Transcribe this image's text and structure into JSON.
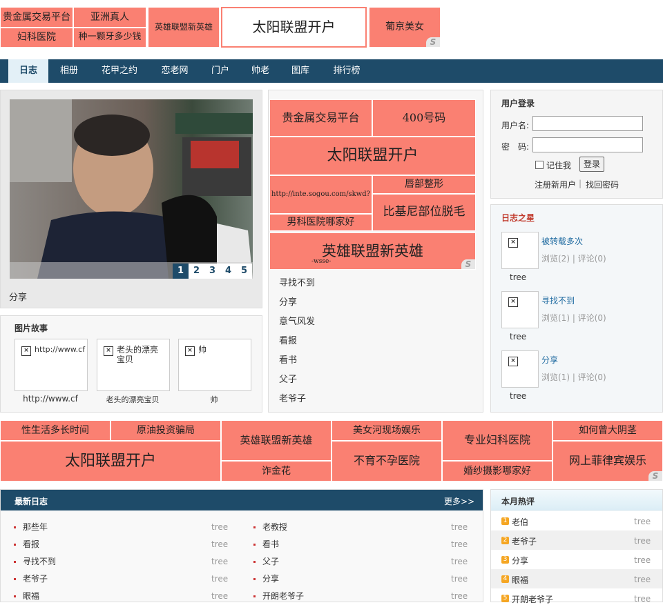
{
  "top_ads": {
    "a1": "贵金属交易平台",
    "a2": "亚洲真人",
    "a3": "妇科医院",
    "a4": "种一颗牙多少钱",
    "a5": "英雄联盟新英雄",
    "a6": "太阳联盟开户",
    "a7": "葡京美女"
  },
  "nav": [
    "日志",
    "相册",
    "花甲之约",
    "恋老网",
    "门户",
    "帅老",
    "图库",
    "排行榜"
  ],
  "slideshow": {
    "pages": [
      "1",
      "2",
      "3",
      "4",
      "5"
    ],
    "caption": "分享"
  },
  "photo_story": {
    "title": "图片故事",
    "items": [
      {
        "thumb_text": "http://www.cf",
        "caption": "http://www.cf"
      },
      {
        "thumb_text": "老头的漂亮宝贝",
        "caption": "老头的漂亮宝贝"
      },
      {
        "thumb_text": "帅",
        "caption": "帅"
      }
    ]
  },
  "mid_ads": {
    "m1": "贵金属交易平台",
    "m2": "400号码",
    "m3": "太阳联盟开户",
    "m4": "http://inte.sogou.com/skwd?",
    "m5": "唇部整形",
    "m6": "比基尼部位脱毛",
    "m7": "男科医院哪家好",
    "m8": "英雄联盟新英雄",
    "m8_sub": "-wsse-"
  },
  "mid_list": [
    "寻找不到",
    "分享",
    "意气风发",
    "看报",
    "看书",
    "父子",
    "老爷子"
  ],
  "login": {
    "title": "用户登录",
    "username_label": "用户名:",
    "password_label": "密　码:",
    "remember": "记住我",
    "submit": "登录",
    "register": "注册新用户",
    "sep": "|",
    "forgot": "找回密码"
  },
  "star": {
    "title": "日志之星",
    "items": [
      {
        "title": "被转载多次",
        "stats": "浏览(2) | 评论(0)",
        "user": "tree"
      },
      {
        "title": "寻找不到",
        "stats": "浏览(1) | 评论(0)",
        "user": "tree"
      },
      {
        "title": "分享",
        "stats": "浏览(1) | 评论(0)",
        "user": "tree"
      }
    ]
  },
  "band_ads": {
    "b1": "性生活多长时间",
    "b2": "原油投资骗局",
    "b3": "英雄联盟新英雄",
    "b4": "美女河现场娱乐",
    "b5": "专业妇科医院",
    "b6": "如何曾大阴茎",
    "b7": "太阳联盟开户",
    "b8": "不育不孕医院",
    "b9": "网上菲律宾娱乐",
    "b10": "诈金花",
    "b11": "婚纱摄影哪家好"
  },
  "latest": {
    "title": "最新日志",
    "more": "更多>>",
    "left": [
      {
        "title": "那些年",
        "user": "tree"
      },
      {
        "title": "看报",
        "user": "tree"
      },
      {
        "title": "寻找不到",
        "user": "tree"
      },
      {
        "title": "老爷子",
        "user": "tree"
      },
      {
        "title": "眼福",
        "user": "tree"
      }
    ],
    "right": [
      {
        "title": "老教授",
        "user": "tree"
      },
      {
        "title": "看书",
        "user": "tree"
      },
      {
        "title": "父子",
        "user": "tree"
      },
      {
        "title": "分享",
        "user": "tree"
      },
      {
        "title": "开朗老爷子",
        "user": "tree"
      }
    ]
  },
  "hot": {
    "title": "本月热评",
    "items": [
      {
        "num": "1",
        "title": "老伯",
        "user": "tree"
      },
      {
        "num": "2",
        "title": "老爷子",
        "user": "tree"
      },
      {
        "num": "3",
        "title": "分享",
        "user": "tree"
      },
      {
        "num": "4",
        "title": "眼福",
        "user": "tree"
      },
      {
        "num": "5",
        "title": "开朗老爷子",
        "user": "tree"
      }
    ]
  },
  "colors": {
    "ad": "#fa8072",
    "nav": "#1e4b69",
    "star_title": "#c0392b"
  }
}
